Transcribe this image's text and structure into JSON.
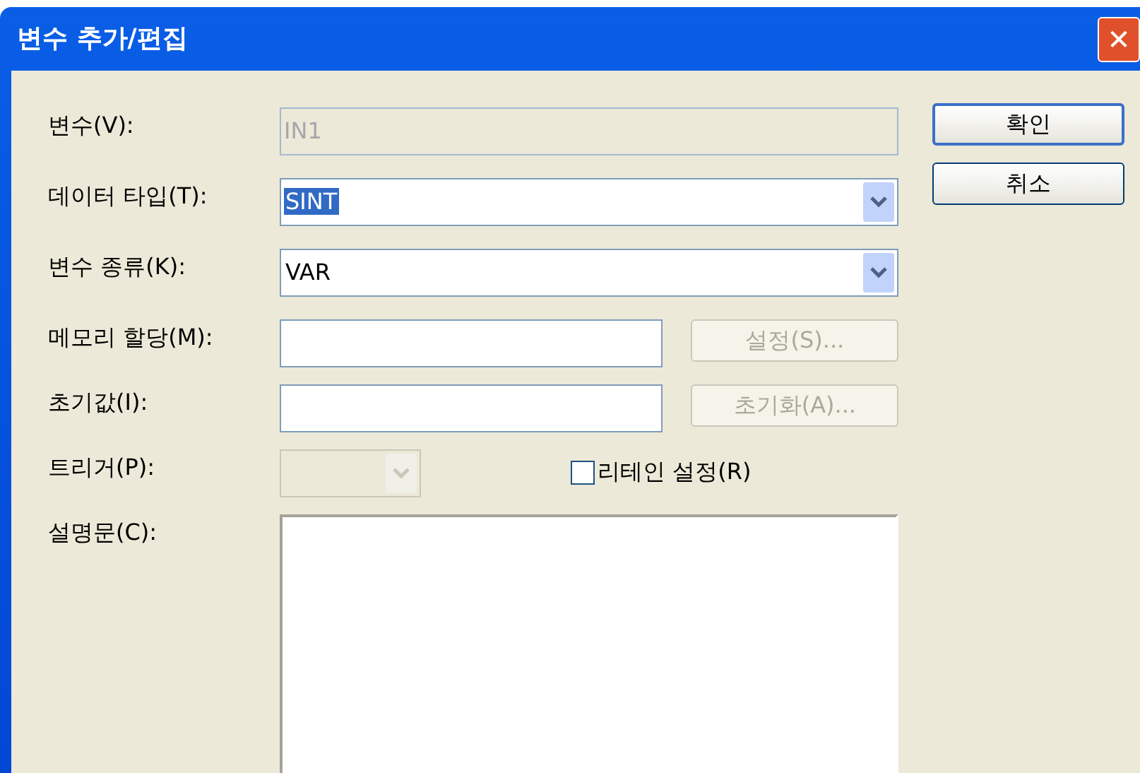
{
  "window": {
    "title": "변수 추가/편집",
    "close": "✕"
  },
  "fields": [
    {
      "kind": "text",
      "label": "변수(V):",
      "value": "IN1",
      "disabled": true
    },
    {
      "kind": "combo",
      "label": "데이터 타입(T):",
      "value": "SINT",
      "disabled": false,
      "selected": true
    },
    {
      "kind": "combo",
      "label": "변수 종류(K):",
      "value": "VAR",
      "disabled": false,
      "selected": false
    },
    {
      "kind": "text_button",
      "label": "메모리 할당(M):",
      "disabled": false,
      "button": {
        "label": "설정(S)...",
        "disabled": true
      }
    },
    {
      "kind": "text_button",
      "label": "초기값(I):",
      "disabled": false,
      "button": {
        "label": "초기화(A)...",
        "disabled": true
      }
    },
    {
      "kind": "combo_check",
      "label": "트리거(P):",
      "disabled": true,
      "checkbox": {
        "label": "리테인 설정(R)",
        "checked": false
      }
    },
    {
      "kind": "memo",
      "label": "설명문(C):",
      "disabled": false
    }
  ],
  "buttons": [
    {
      "label": "확인",
      "default": true
    },
    {
      "label": "취소",
      "default": false
    }
  ]
}
